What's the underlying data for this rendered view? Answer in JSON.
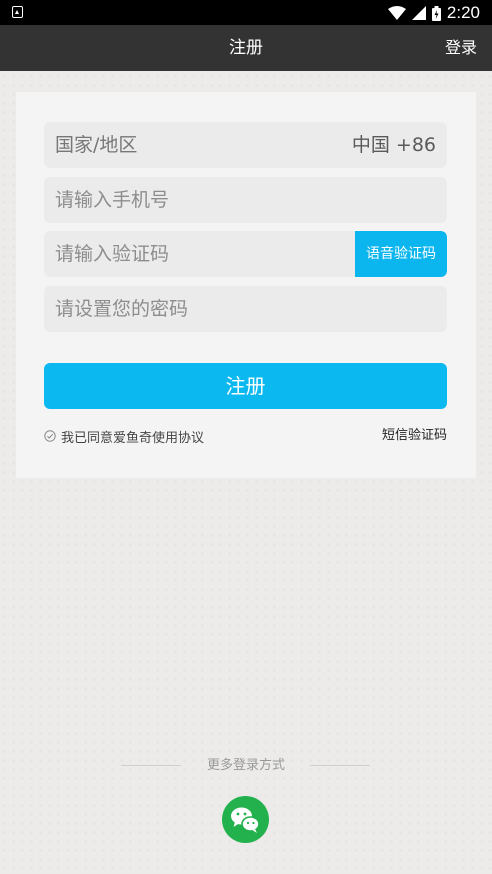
{
  "status_bar": {
    "time": "2:20"
  },
  "header": {
    "title": "注册",
    "login_label": "登录"
  },
  "form": {
    "region_label": "国家/地区",
    "region_value": "中国 +86",
    "phone_placeholder": "请输入手机号",
    "code_placeholder": "请输入验证码",
    "voice_code_label": "语音验证码",
    "password_placeholder": "请设置您的密码",
    "register_label": "注册",
    "agreement_label": "我已同意爱鱼奇使用协议",
    "sms_code_label": "短信验证码"
  },
  "footer": {
    "more_login_label": "更多登录方式"
  },
  "colors": {
    "accent": "#0bb8ef",
    "nav_bg": "#333333",
    "wechat": "#22b14c"
  }
}
